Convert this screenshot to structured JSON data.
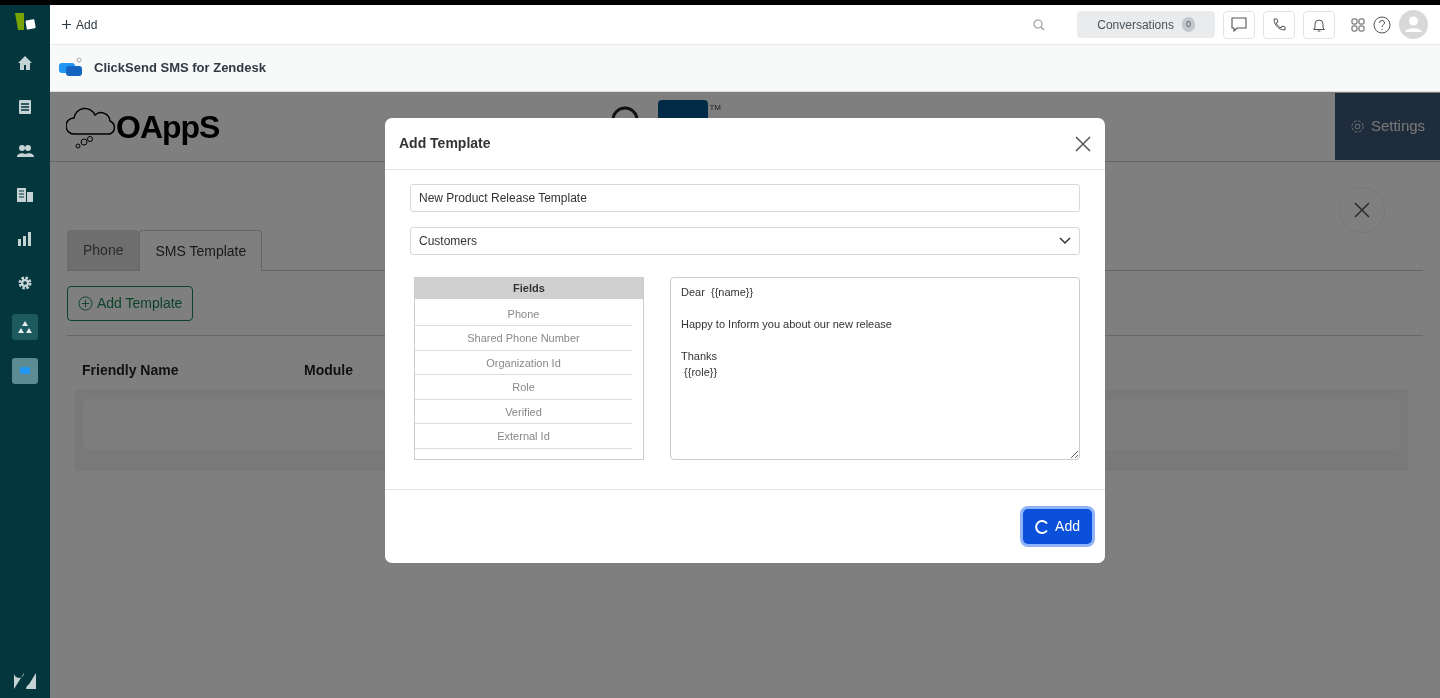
{
  "sidebar": {
    "items": [
      {
        "kind": "home",
        "selected": false
      },
      {
        "kind": "views",
        "selected": false
      },
      {
        "kind": "customers",
        "selected": false
      },
      {
        "kind": "organizations",
        "selected": false
      },
      {
        "kind": "reporting",
        "selected": false
      },
      {
        "kind": "admin",
        "selected": false
      },
      {
        "kind": "app-tree",
        "selected": false
      },
      {
        "kind": "app-chat",
        "selected": true
      }
    ]
  },
  "topbar": {
    "add_label": "Add",
    "conversations": {
      "label": "Conversations",
      "count": "0"
    }
  },
  "app_header": {
    "title": "ClickSend SMS for Zendesk"
  },
  "page": {
    "brand": "OAppS",
    "partner_logo_mark": "TM",
    "settings_label": "Settings",
    "tabs": [
      {
        "label": "Phone",
        "selected": false
      },
      {
        "label": "SMS Template",
        "selected": true
      }
    ],
    "add_template_label": "Add Template",
    "table": {
      "columns": [
        "Friendly Name",
        "Module"
      ]
    }
  },
  "modal": {
    "title": "Add Template",
    "name_value": "New Product Release Template",
    "module_value": "Customers",
    "fields_header": "Fields",
    "fields": [
      "Phone",
      "Shared Phone Number",
      "Organization Id",
      "Role",
      "Verified",
      "External Id"
    ],
    "message_value": "Dear  {{name}}\n\nHappy to Inform you about our new release\n\nThanks\n {{role}}",
    "submit": {
      "label": "Add",
      "loading": true
    }
  }
}
